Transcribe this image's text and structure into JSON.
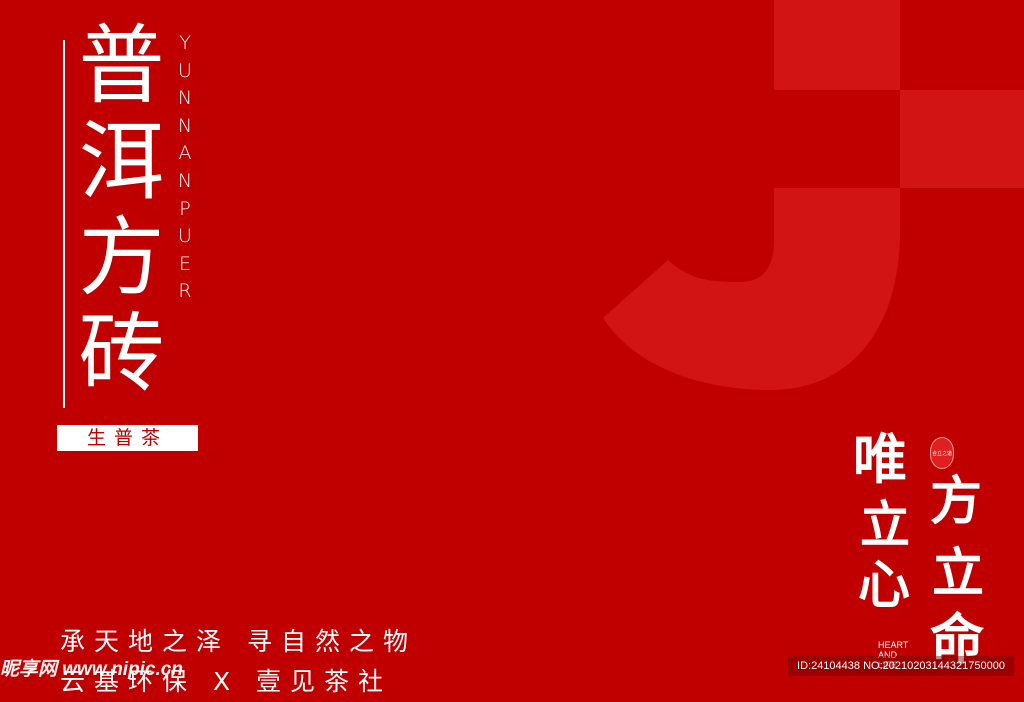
{
  "title_chars": [
    "普",
    "洱",
    "方",
    "砖"
  ],
  "pinyin_chars": [
    "Y",
    "U",
    "N",
    "N",
    "A",
    "N",
    "P",
    "U",
    "E",
    "R"
  ],
  "tag_label": "生普茶",
  "slogan_line1": "承天地之泽 寻自然之物",
  "slogan_line2": "云基环保 X 壹见茶社",
  "calligraphy": {
    "col1": [
      "唯",
      "立",
      "心"
    ],
    "col2": [
      "方",
      "立",
      "命"
    ],
    "seal_text": "合立之道",
    "english": [
      "HEART",
      "AND",
      "LIFE"
    ]
  },
  "watermark_logo": "昵享网 www.nipic.cn",
  "watermark_id": "ID:24104438 NO:20210203144321750000",
  "colors": {
    "background": "#c00000",
    "shape": "#d21414",
    "text": "#ffffff"
  }
}
